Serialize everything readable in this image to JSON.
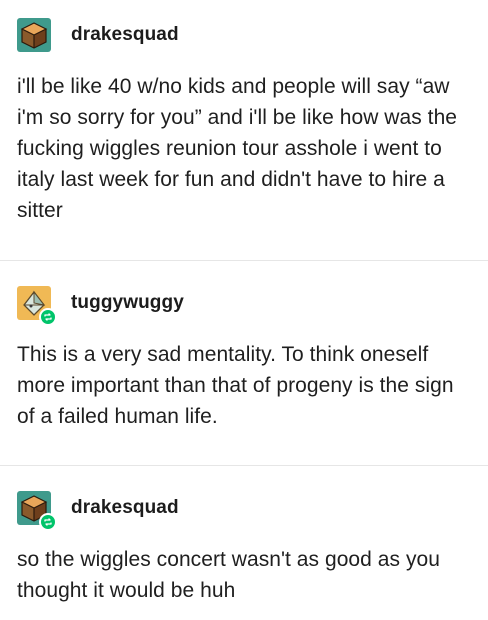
{
  "posts": [
    {
      "username": "drakesquad",
      "avatar_icon": "cube-avatar-icon",
      "reblogged": false,
      "text": "i'll be like 40 w/no kids and people will say “aw i'm so sorry for you” and i'll be like how was the fucking wiggles reunion tour asshole i went to italy last week for fun and didn't have to hire a sitter"
    },
    {
      "username": "tuggywuggy",
      "avatar_icon": "folder-avatar-icon",
      "reblogged": true,
      "text": "This is a very sad mentality. To think oneself more important than that of progeny is the sign of a failed human life."
    },
    {
      "username": "drakesquad",
      "avatar_icon": "cube-avatar-icon",
      "reblogged": true,
      "text": "so the wiggles concert wasn't as good as you thought it would be huh"
    }
  ],
  "colors": {
    "reblog_badge": "#00c46a",
    "divider": "#e6e6e6"
  }
}
